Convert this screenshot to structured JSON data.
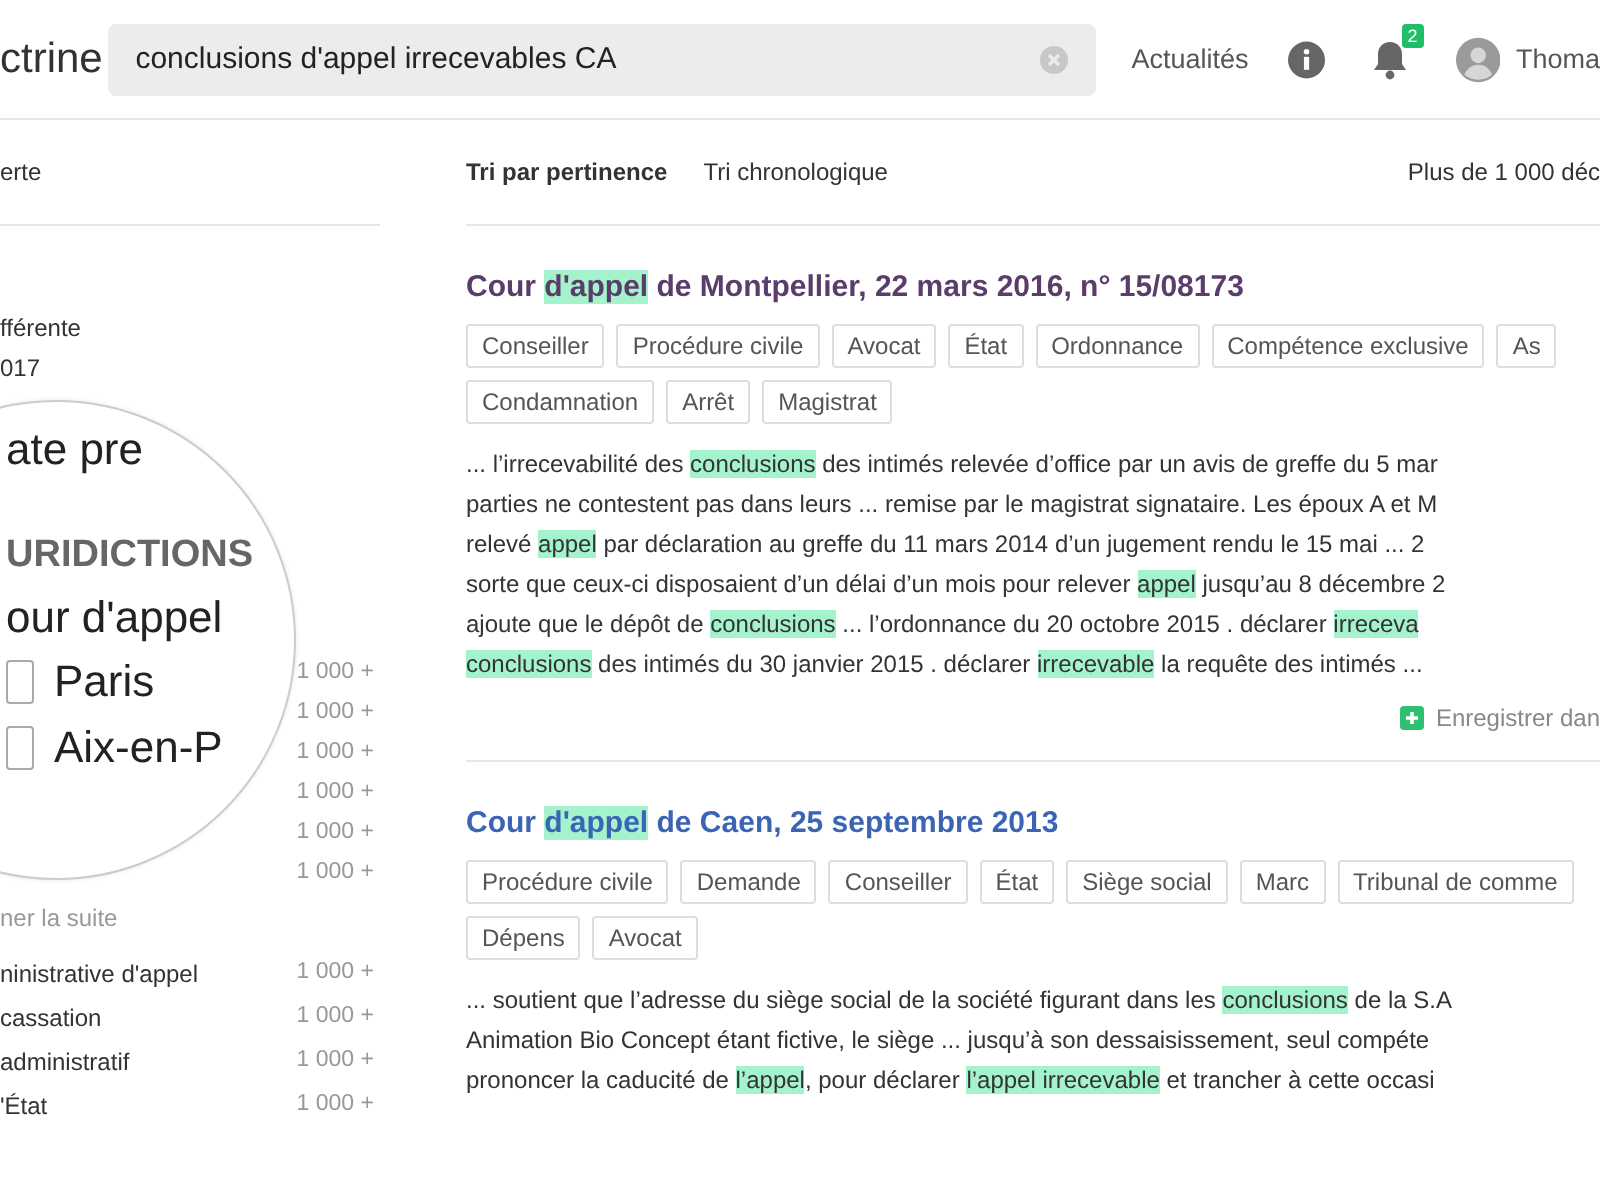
{
  "header": {
    "logo": "ctrine",
    "search": {
      "value": "conclusions d'appel irrecevables CA"
    },
    "news_link": "Actualités",
    "notifications": {
      "count": "2"
    },
    "user": {
      "name": "Thoma"
    }
  },
  "sidebar": {
    "top_label": "erte",
    "filter_lines": [
      "fférente",
      "017"
    ],
    "magnifier": [
      {
        "kind": "text",
        "text": "ate pre"
      },
      {
        "kind": "heading",
        "text": "URIDICTIONS"
      },
      {
        "kind": "text",
        "text": "our d'appel"
      },
      {
        "kind": "checkbox",
        "text": "Paris",
        "checked": false
      },
      {
        "kind": "checkbox",
        "text": "Aix-en-P",
        "checked": false
      }
    ],
    "covered_counts": [
      "1 000 +",
      "1 000 +",
      "1 000 +",
      "1 000 +",
      "1 000 +",
      "1 000 +"
    ],
    "show_more": "ner la suite",
    "courts": [
      {
        "name": "ninistrative d'appel",
        "count": "1 000 +"
      },
      {
        "name": "cassation",
        "count": "1 000 +"
      },
      {
        "name": "administratif",
        "count": "1 000 +"
      },
      {
        "name": "'État",
        "count": "1 000 +"
      }
    ]
  },
  "sort": {
    "options": [
      {
        "label": "Tri par pertinence",
        "selected": true
      },
      {
        "label": "Tri chronologique",
        "selected": false
      }
    ],
    "result_count": "Plus de 1 000 déc"
  },
  "results": [
    {
      "visited": true,
      "title": [
        {
          "text": "Cour ",
          "highlight": false
        },
        {
          "text": "d'appel",
          "highlight": true
        },
        {
          "text": " de Montpellier, 22 mars 2016, n° 15/08173",
          "highlight": false
        }
      ],
      "tag_rows": [
        [
          "Conseiller",
          "Procédure civile",
          "Avocat",
          "État",
          "Ordonnance",
          "Compétence exclusive",
          "As"
        ],
        [
          "Condamnation",
          "Arrêt",
          "Magistrat"
        ]
      ],
      "snippet_lines": [
        [
          {
            "text": "... l’irrecevabilité des ",
            "highlight": false
          },
          {
            "text": "conclusions",
            "highlight": true
          },
          {
            "text": " des intimés relevée d’office par un avis de greffe du 5 mar",
            "highlight": false
          }
        ],
        [
          {
            "text": "parties ne contestent pas dans leurs  ...  remise par le magistrat signataire. Les époux A et M",
            "highlight": false
          }
        ],
        [
          {
            "text": "relevé ",
            "highlight": false
          },
          {
            "text": "appel",
            "highlight": true
          },
          {
            "text": " par déclaration au greffe du 11 mars 2014 d’un jugement rendu le 15 mai  ...  2",
            "highlight": false
          }
        ],
        [
          {
            "text": "sorte que ceux-ci disposaient d’un délai d’un mois pour relever ",
            "highlight": false
          },
          {
            "text": "appel",
            "highlight": true
          },
          {
            "text": " jusqu’au 8 décembre 2",
            "highlight": false
          }
        ],
        [
          {
            "text": "ajoute que le dépôt de ",
            "highlight": false
          },
          {
            "text": "conclusions",
            "highlight": true
          },
          {
            "text": "  ...  l’ordonnance du 20 octobre 2015 . déclarer ",
            "highlight": false
          },
          {
            "text": "irreceva",
            "highlight": true
          }
        ],
        [
          {
            "text": "conclusions",
            "highlight": true
          },
          {
            "text": " des intimés du 30 janvier 2015 . déclarer ",
            "highlight": false
          },
          {
            "text": "irrecevable",
            "highlight": true
          },
          {
            "text": " la requête des intimés ...",
            "highlight": false
          }
        ]
      ],
      "save_label": "Enregistrer dan"
    },
    {
      "visited": false,
      "title": [
        {
          "text": "Cour ",
          "highlight": false
        },
        {
          "text": "d'appel",
          "highlight": true
        },
        {
          "text": " de Caen, 25 septembre 2013",
          "highlight": false
        }
      ],
      "tag_rows": [
        [
          "Procédure civile",
          "Demande",
          "Conseiller",
          "État",
          "Siège social",
          "Marc",
          "Tribunal de comme"
        ],
        [
          "Dépens",
          "Avocat"
        ]
      ],
      "snippet_lines": [
        [
          {
            "text": "... soutient que l’adresse du siège social de la société figurant dans les ",
            "highlight": false
          },
          {
            "text": "conclusions",
            "highlight": true
          },
          {
            "text": " de la S.A",
            "highlight": false
          }
        ],
        [
          {
            "text": "Animation Bio Concept étant fictive, le siège  ...  jusqu’à son dessaisissement, seul compéte",
            "highlight": false
          }
        ],
        [
          {
            "text": "prononcer la caducité de ",
            "highlight": false
          },
          {
            "text": "l’appel",
            "highlight": true
          },
          {
            "text": ", pour déclarer ",
            "highlight": false
          },
          {
            "text": "l’appel",
            "highlight": true
          },
          {
            "text": " irrecevable",
            "highlight": true
          },
          {
            "text": " et trancher à cette occasi",
            "highlight": false
          }
        ]
      ]
    }
  ]
}
